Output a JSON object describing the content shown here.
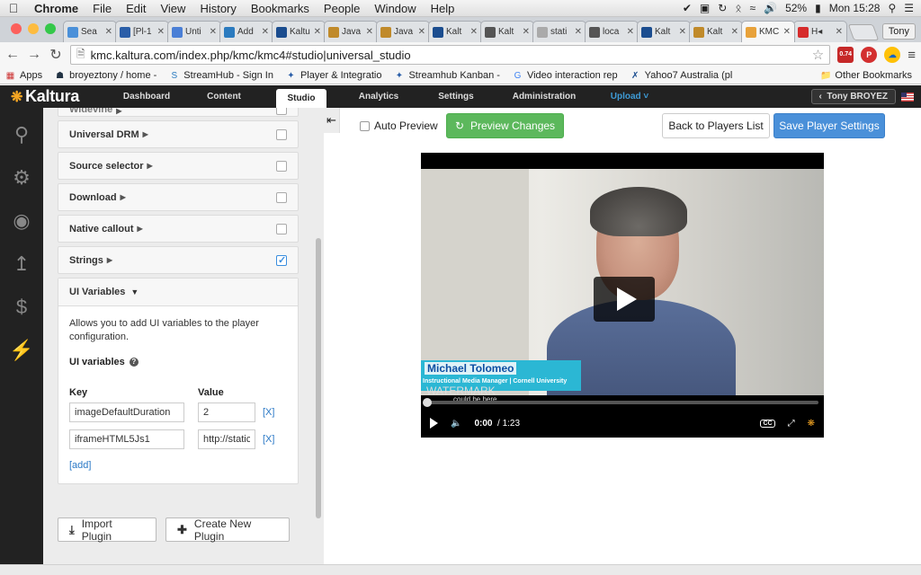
{
  "menubar": {
    "items": [
      "Chrome",
      "File",
      "Edit",
      "View",
      "History",
      "Bookmarks",
      "People",
      "Window",
      "Help"
    ],
    "battery": "52%",
    "clock": "Mon 15:28"
  },
  "tabs": [
    {
      "label": "Sea",
      "color": "#4a90d9"
    },
    {
      "label": "[Pl-1",
      "color": "#2a5ea8"
    },
    {
      "label": "Unti",
      "color": "#4a7fd6"
    },
    {
      "label": "Add",
      "color": "#2b7bbf"
    },
    {
      "label": "Kaltu",
      "color": "#1b4d8f"
    },
    {
      "label": "Java",
      "color": "#c08a2a"
    },
    {
      "label": "Java",
      "color": "#c08a2a"
    },
    {
      "label": "Kalt",
      "color": "#1b4d8f"
    },
    {
      "label": "Kalt",
      "color": "#555555"
    },
    {
      "label": "stati",
      "color": "#aaaaaa"
    },
    {
      "label": "loca",
      "color": "#555555"
    },
    {
      "label": "Kalt",
      "color": "#1b4d8f"
    },
    {
      "label": "Kalt",
      "color": "#c08a2a"
    },
    {
      "label": "KMC",
      "color": "#e8a23a"
    },
    {
      "label": "H◂",
      "color": "#d62b2b"
    }
  ],
  "profile": "Tony",
  "omnibox": {
    "url": "kmc.kaltura.com/index.php/kmc/kmc4#studio|universal_studio"
  },
  "extensions": {
    "badge": "0.74"
  },
  "bookmarks": [
    "Apps",
    "broyeztony / home -",
    "StreamHub - Sign In",
    "Player & Integratio",
    "Streamhub Kanban -",
    "Video interaction rep",
    "Yahoo7 Australia (pl"
  ],
  "bookmarks_other": "Other Bookmarks",
  "kaltura": {
    "logo": "Kaltura",
    "nav": [
      "Dashboard",
      "Content",
      "Studio",
      "Analytics",
      "Settings",
      "Administration",
      "Upload"
    ],
    "user": "Tony BROYEZ"
  },
  "plugins": {
    "cut_top": "Widevine",
    "rows": [
      {
        "label": "Universal DRM",
        "checked": false
      },
      {
        "label": "Source selector",
        "checked": false
      },
      {
        "label": "Download",
        "checked": false
      },
      {
        "label": "Native callout",
        "checked": false
      },
      {
        "label": "Strings",
        "checked": true
      }
    ],
    "ui_variables": {
      "title": "UI Variables",
      "description": "Allows you to add UI variables to the player configuration.",
      "subtitle": "UI variables",
      "key_header": "Key",
      "value_header": "Value",
      "rows": [
        {
          "key": "imageDefaultDuration",
          "value": "2",
          "remove": "[X]"
        },
        {
          "key": "iframeHTML5Js1",
          "value": "http://static",
          "remove": "[X]"
        }
      ],
      "add": "[add]"
    },
    "import_label": "Import Plugin",
    "create_label": "Create New Plugin"
  },
  "controls": {
    "auto_preview": "Auto Preview",
    "preview": "Preview Changes",
    "back": "Back to Players List",
    "save": "Save Player Settings"
  },
  "player": {
    "name": "Michael Tolomeo",
    "role": "Instructional Media Manager | Cornell University",
    "watermark": "WATERMARK",
    "watermark_sub": "could be here",
    "time": "0:00",
    "duration": "/ 1:23",
    "progress": 0
  }
}
